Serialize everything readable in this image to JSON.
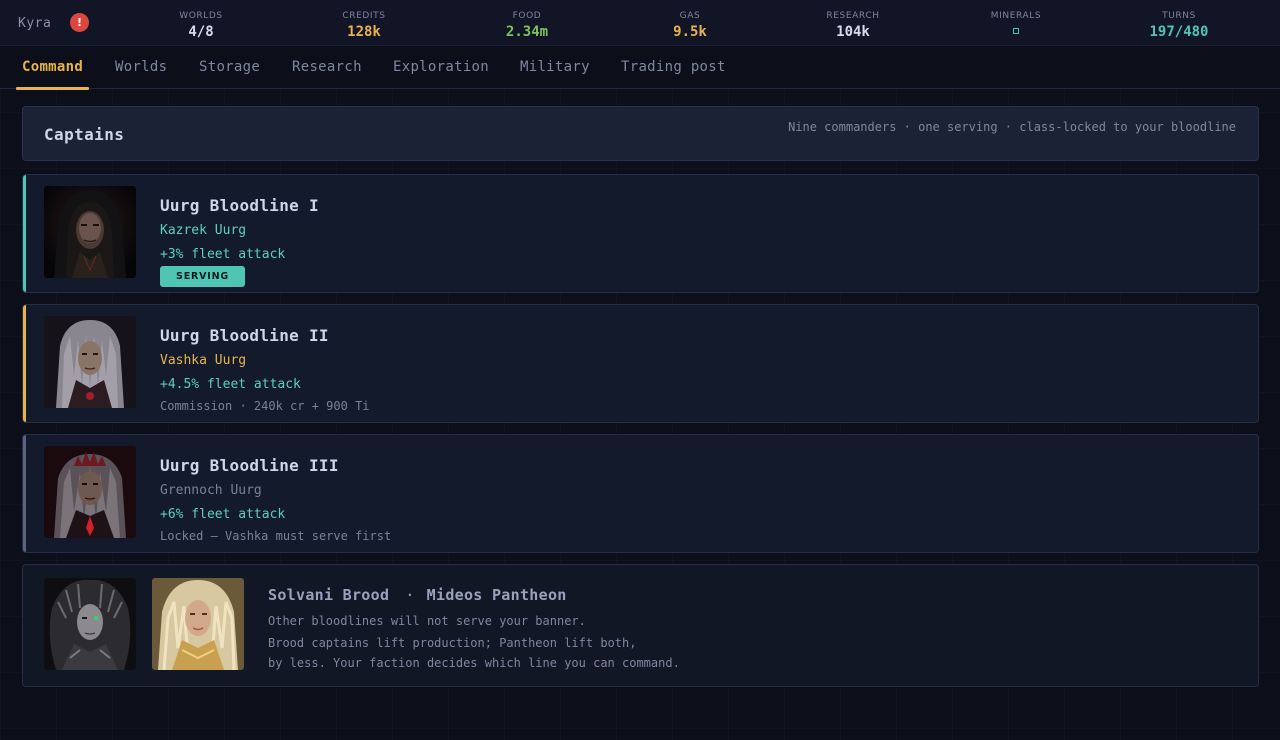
{
  "player": {
    "name": "Kyra",
    "alert_glyph": "!"
  },
  "resources": [
    {
      "label": "WORLDS",
      "value": "4/8",
      "color": "#d7dcec"
    },
    {
      "label": "CREDITS",
      "value": "128k",
      "color": "#e8b44a"
    },
    {
      "label": "FOOD",
      "value": "2.34m",
      "color": "#7fc25b"
    },
    {
      "label": "GAS",
      "value": "9.5k",
      "color": "#e8b44a"
    },
    {
      "label": "RESEARCH",
      "value": "104k",
      "color": "#d7dcec"
    },
    {
      "label": "MINERALS",
      "value": "",
      "icon": "mineral-icon",
      "color": "#4fc6b3"
    },
    {
      "label": "TURNS",
      "value": "197/480",
      "color": "#4fc6b3"
    }
  ],
  "tabs": [
    {
      "label": "Command",
      "active": true
    },
    {
      "label": "Worlds"
    },
    {
      "label": "Storage"
    },
    {
      "label": "Research"
    },
    {
      "label": "Exploration"
    },
    {
      "label": "Military"
    },
    {
      "label": "Trading post"
    }
  ],
  "header": {
    "title": "Captains",
    "subtitle": "Nine commanders · one serving · class-locked to your bloodline"
  },
  "captains": [
    {
      "title": "Uurg Bloodline I",
      "name": "Kazrek Uurg",
      "name_color": "#5fd0b8",
      "bonus": "+3% fleet attack",
      "badge": "SERVING",
      "note": "",
      "stripe_color": "#4fc6b3",
      "portrait_icon": "hooded-warlord-portrait"
    },
    {
      "title": "Uurg Bloodline II",
      "name": "Vashka Uurg",
      "name_color": "#e8b44a",
      "bonus": "+4.5% fleet attack",
      "badge": "",
      "note": "Commission · 240k cr + 900 Ti",
      "stripe_color": "#e8b44a",
      "portrait_icon": "silver-haired-warrior-portrait"
    },
    {
      "title": "Uurg Bloodline III",
      "name": "Grennoch Uurg",
      "name_color": "#7a8099",
      "bonus": "+6% fleet attack",
      "badge": "",
      "note": "Locked — Vashka must serve first",
      "stripe_color": "#5c6380",
      "portrait_icon": "crowned-dark-lord-portrait"
    }
  ],
  "other_factions": {
    "faction_a": "Solvani Brood",
    "separator": "·",
    "faction_b": "Mideos Pantheon",
    "lines": [
      "Other bloodlines will not serve your banner.",
      "Brood captains lift production; Pantheon lift both,",
      "by less. Your faction decides which line you can command."
    ],
    "portraits": [
      "biomech-queen-portrait",
      "golden-goddess-portrait"
    ]
  }
}
